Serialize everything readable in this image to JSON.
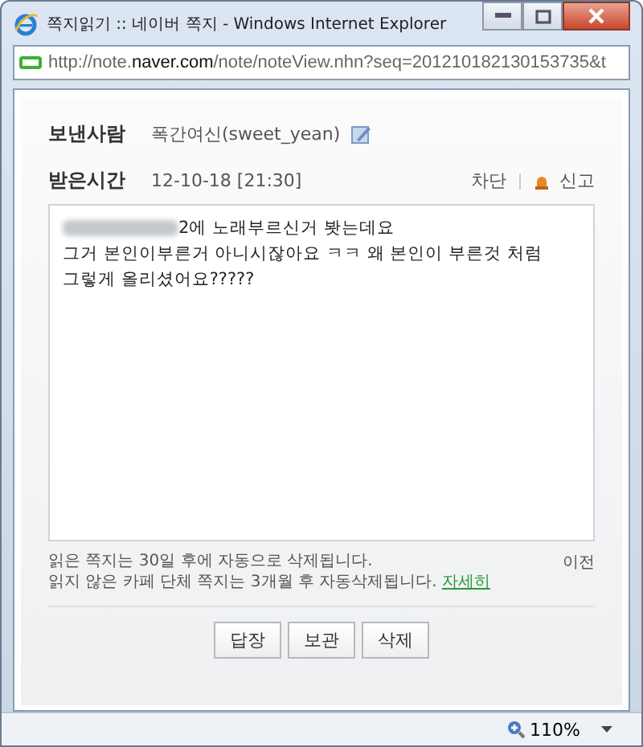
{
  "window": {
    "title": "쪽지읽기 :: 네이버 쪽지 - Windows Internet Explorer"
  },
  "address_bar": {
    "url_prefix": "http://note.",
    "url_domain": "naver.com",
    "url_rest": "/note/noteView.nhn?seq=20121018213015373​5&t"
  },
  "sender": {
    "label": "보낸사람",
    "value": "폭간여신(sweet_yean)"
  },
  "received": {
    "label": "받은시간",
    "value": "12-10-18 [21:30]",
    "block": "차단",
    "report": "신고"
  },
  "message": {
    "redacted": true,
    "lines": [
      "2에 노래부르신거 봣는데요",
      "그거 본인이부른거 아니시잖아요 ㅋㅋ 왜 본인이 부른것 처럼",
      "그렇게 올리셨어요?????"
    ]
  },
  "notice": {
    "line_1": "읽은 쪽지는 30일 후에 자동으로 삭제됩니다.",
    "line_2": "읽지 않은 카페 단체 쪽지는 3개월 후 자동삭제됩니다.",
    "link": "자세히",
    "previous": "이전"
  },
  "buttons": [
    "답장",
    "보관",
    "삭제"
  ],
  "status_bar": {
    "zoom": "110%"
  }
}
